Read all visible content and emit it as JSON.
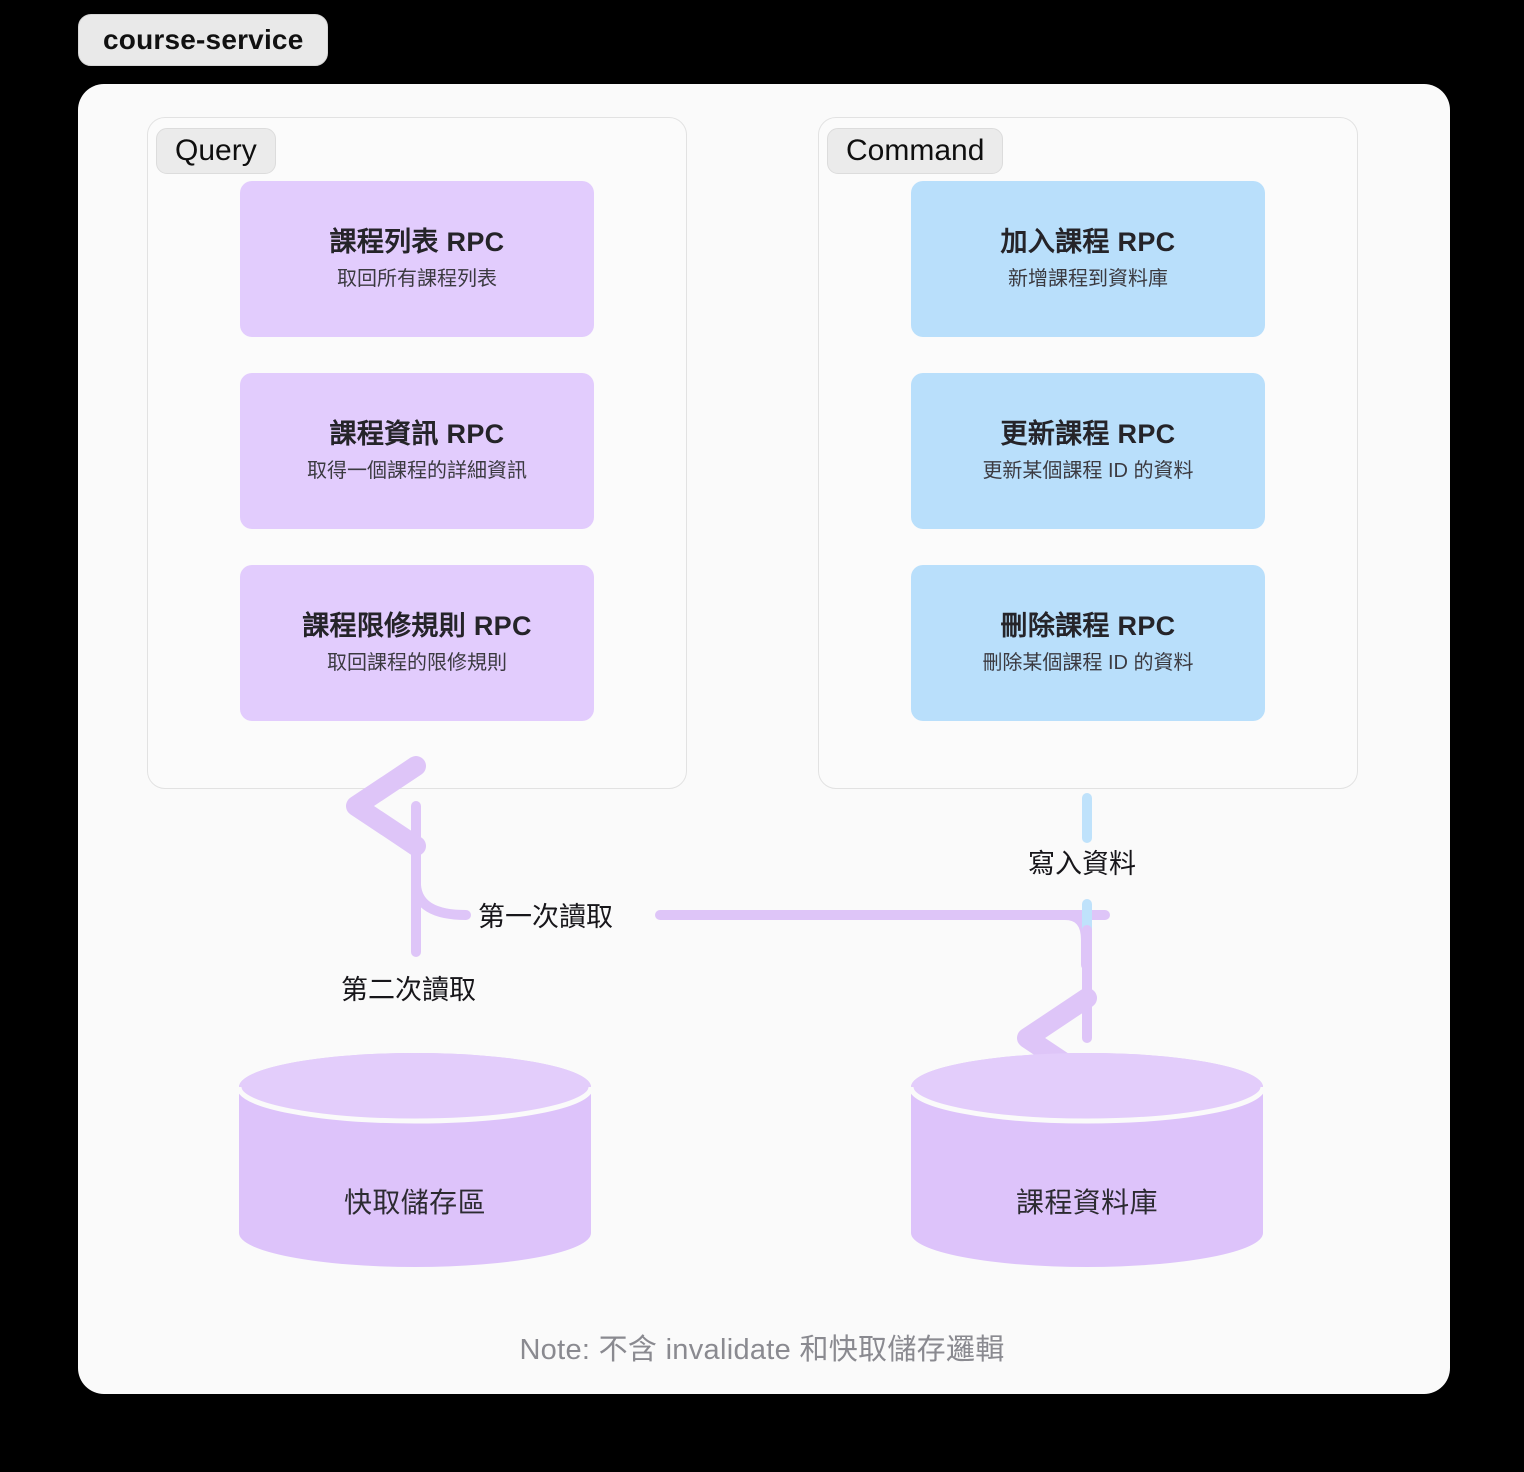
{
  "service": {
    "name": "course-service",
    "note": "Note: 不含 invalidate 和快取儲存邏輯"
  },
  "groups": [
    {
      "id": "query",
      "label": "Query",
      "accent": "#e2ccfd",
      "cards": [
        {
          "title": "課程列表 RPC",
          "desc": "取回所有課程列表"
        },
        {
          "title": "課程資訊 RPC",
          "desc": "取得一個課程的詳細資訊"
        },
        {
          "title": "課程限修規則 RPC",
          "desc": "取回課程的限修規則"
        }
      ]
    },
    {
      "id": "command",
      "label": "Command",
      "accent": "#b9dffb",
      "cards": [
        {
          "title": "加入課程 RPC",
          "desc": "新增課程到資料庫"
        },
        {
          "title": "更新課程 RPC",
          "desc": "更新某個課程 ID 的資料"
        },
        {
          "title": "刪除課程 RPC",
          "desc": "刪除某個課程 ID 的資料"
        }
      ]
    }
  ],
  "edges": {
    "first_read": "第一次讀取",
    "second_read": "第二次讀取",
    "write": "寫入資料"
  },
  "datastores": [
    {
      "id": "cache",
      "label": "快取儲存區",
      "color": "#ddc3fa"
    },
    {
      "id": "database",
      "label": "課程資料庫",
      "color": "#ddc3fa"
    }
  ],
  "colors": {
    "background": "#000000",
    "panel": "#fafafa",
    "query_card": "#e2ccfd",
    "command_card": "#b9dffb",
    "arrow_purple": "#dec5f8",
    "arrow_blue": "#bfe2fb",
    "note_text": "#8a8a90"
  }
}
